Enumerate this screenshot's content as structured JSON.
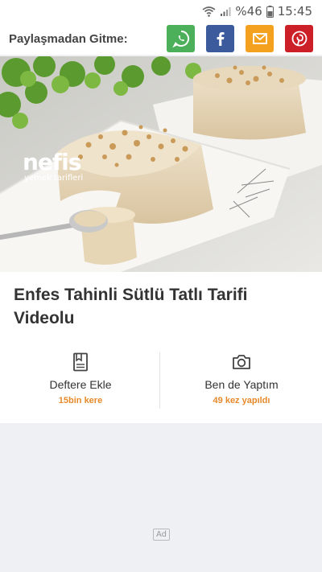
{
  "status_bar": {
    "battery": "%46",
    "time": "15:45",
    "icons": [
      "wifi-icon",
      "signal-icon",
      "battery-icon"
    ]
  },
  "share_bar": {
    "label": "Paylaşmadan Gitme:",
    "buttons": [
      {
        "name": "whatsapp",
        "icon": "whatsapp-icon",
        "color": "#4cb05a"
      },
      {
        "name": "facebook",
        "icon": "facebook-icon",
        "color": "#3b5b9c"
      },
      {
        "name": "mail",
        "icon": "mail-icon",
        "color": "#f5a120"
      },
      {
        "name": "pinterest",
        "icon": "pinterest-icon",
        "color": "#cc1f28"
      }
    ]
  },
  "hero": {
    "logo_main": "nefis",
    "logo_sub": "yemek tarifleri"
  },
  "recipe": {
    "title": "Enfes Tahinli Sütlü Tatlı Tarifi Videolu"
  },
  "actions": [
    {
      "icon": "notebook-icon",
      "label": "Deftere Ekle",
      "count": "15bin kere"
    },
    {
      "icon": "camera-icon",
      "label": "Ben de Yaptım",
      "count": "49 kez yapıldı"
    }
  ],
  "ad": {
    "badge": "Ad"
  },
  "colors": {
    "accent": "#e7892a",
    "title": "#333333",
    "background": "#f0f1f5"
  }
}
